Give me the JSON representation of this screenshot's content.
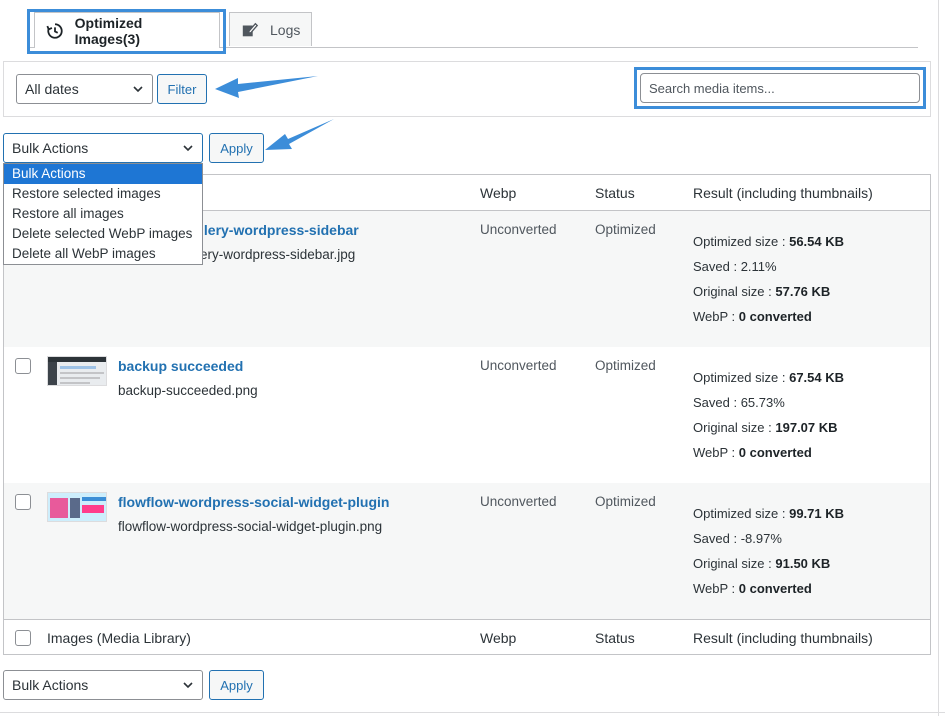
{
  "tabs": [
    {
      "label": "Optimized Images(3)",
      "icon": "history-icon",
      "active": true
    },
    {
      "label": "Logs",
      "icon": "edit-icon",
      "active": false
    }
  ],
  "filter": {
    "date_select": "All dates",
    "filter_label": "Filter",
    "search_placeholder": "Search media items..."
  },
  "bulk_top": {
    "selected": "Bulk Actions",
    "apply_label": "Apply",
    "options": [
      "Bulk Actions",
      "Restore selected images",
      "Restore all images",
      "Delete selected WebP images",
      "Delete all WebP images"
    ]
  },
  "table": {
    "headers": {
      "images": "Images (Media Library)",
      "webp": "Webp",
      "status": "Status",
      "result": "Result (including thumbnails)"
    },
    "rows": [
      {
        "title": "llery-wordpress-sidebar",
        "filename": "ery-wordpress-sidebar.jpg",
        "webp": "Unconverted",
        "status": "Optimized",
        "optimized_label": "Optimized size : ",
        "optimized": "56.54 KB",
        "saved_label": "Saved : ",
        "saved": "2.11%",
        "original_label": "Original size : ",
        "original": "57.76 KB",
        "webp_label": "WebP : ",
        "webp_result": "0 converted"
      },
      {
        "title": "backup succeeded",
        "filename": "backup-succeeded.png",
        "webp": "Unconverted",
        "status": "Optimized",
        "optimized_label": "Optimized size : ",
        "optimized": "67.54 KB",
        "saved_label": "Saved : ",
        "saved": "65.73%",
        "original_label": "Original size : ",
        "original": "197.07 KB",
        "webp_label": "WebP : ",
        "webp_result": "0 converted"
      },
      {
        "title": "flowflow-wordpress-social-widget-plugin",
        "filename": "flowflow-wordpress-social-widget-plugin.png",
        "webp": "Unconverted",
        "status": "Optimized",
        "optimized_label": "Optimized size : ",
        "optimized": "99.71 KB",
        "saved_label": "Saved : ",
        "saved": "-8.97%",
        "original_label": "Original size : ",
        "original": "91.50 KB",
        "webp_label": "WebP : ",
        "webp_result": "0 converted"
      }
    ]
  },
  "bulk_bottom": {
    "selected": "Bulk Actions",
    "apply_label": "Apply"
  },
  "colors": {
    "accent": "#2271b1",
    "highlight": "#3c8dd9",
    "menu_selected": "#1e76d4"
  }
}
